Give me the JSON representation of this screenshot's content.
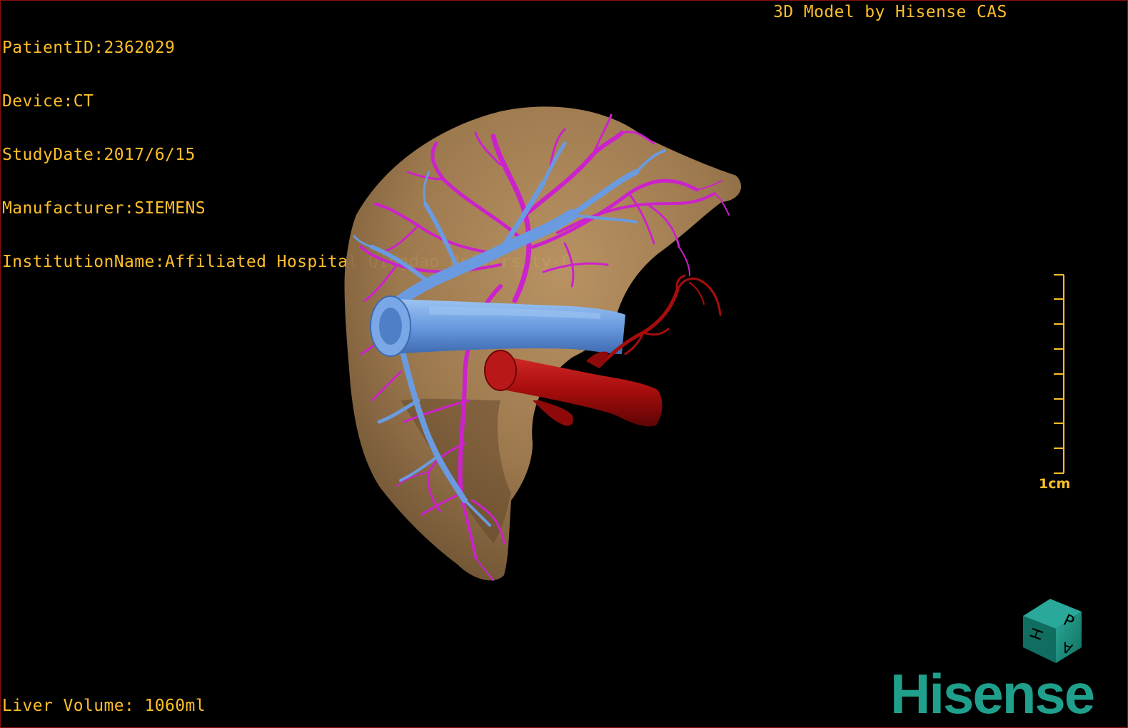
{
  "dicom_info": {
    "patient_id": "PatientID:2362029",
    "device": "Device:CT",
    "study_date": "StudyDate:2017/6/15",
    "manufacturer": "Manufacturer:SIEMENS",
    "institution": "InstitutionName:Affiliated Hospital Qingdao University-C"
  },
  "model_credit": "3D Model by Hisense CAS",
  "liver_volume": "Liver Volume: 1060ml",
  "scale_bar": {
    "label": "1cm"
  },
  "orientation_cube": {
    "face_front": "P",
    "face_left": "H",
    "face_bottom": "A"
  },
  "logo": {
    "text": "Hisense"
  },
  "colors": {
    "overlay_text": "#ffbf2a",
    "liver_parenchyma": "#a57f52",
    "portal_vein": "#6a9be0",
    "hepatic_vein": "#cc22cc",
    "artery": "#a70d0d",
    "logo": "#1fa08c"
  },
  "structures": [
    "liver",
    "portal-vein",
    "hepatic-veins",
    "hepatic-artery",
    "aorta"
  ]
}
